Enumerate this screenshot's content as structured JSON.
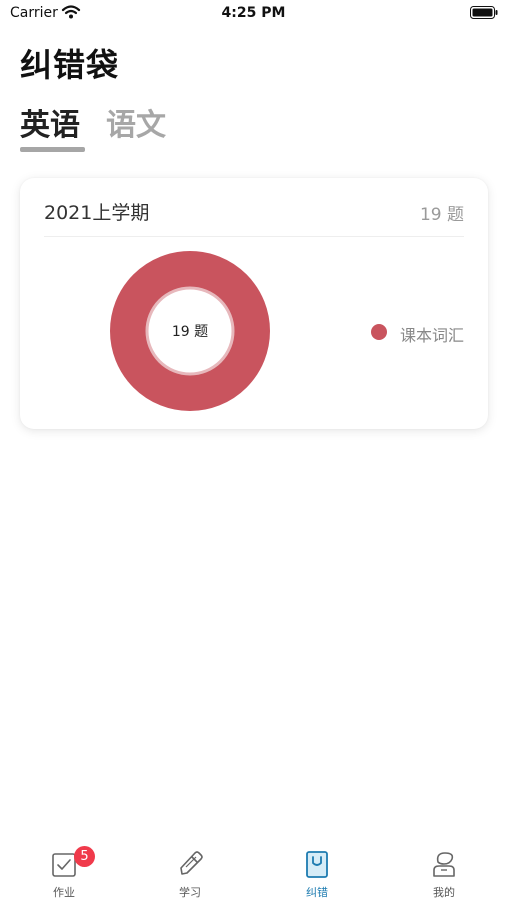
{
  "status_bar": {
    "carrier": "Carrier",
    "time": "4:25 PM"
  },
  "page": {
    "title": "纠错袋"
  },
  "subject_tabs": [
    {
      "label": "英语",
      "active": true
    },
    {
      "label": "语文",
      "active": false
    }
  ],
  "card": {
    "term": "2021上学期",
    "count_label": "19 题",
    "donut_center_label": "19 题",
    "legend": [
      {
        "label": "课本词汇",
        "color": "#c9545e"
      }
    ]
  },
  "chart_data": {
    "type": "pie",
    "categories": [
      "课本词汇"
    ],
    "values": [
      19
    ],
    "colors": [
      "#c9545e"
    ]
  },
  "tab_bar": {
    "items": [
      {
        "label": "作业",
        "icon": "homework-icon",
        "badge": "5",
        "active": false
      },
      {
        "label": "学习",
        "icon": "pencil-icon",
        "active": false
      },
      {
        "label": "纠错",
        "icon": "bag-icon",
        "active": true
      },
      {
        "label": "我的",
        "icon": "profile-icon",
        "active": false
      }
    ],
    "active_color": "#1d7bb0"
  }
}
